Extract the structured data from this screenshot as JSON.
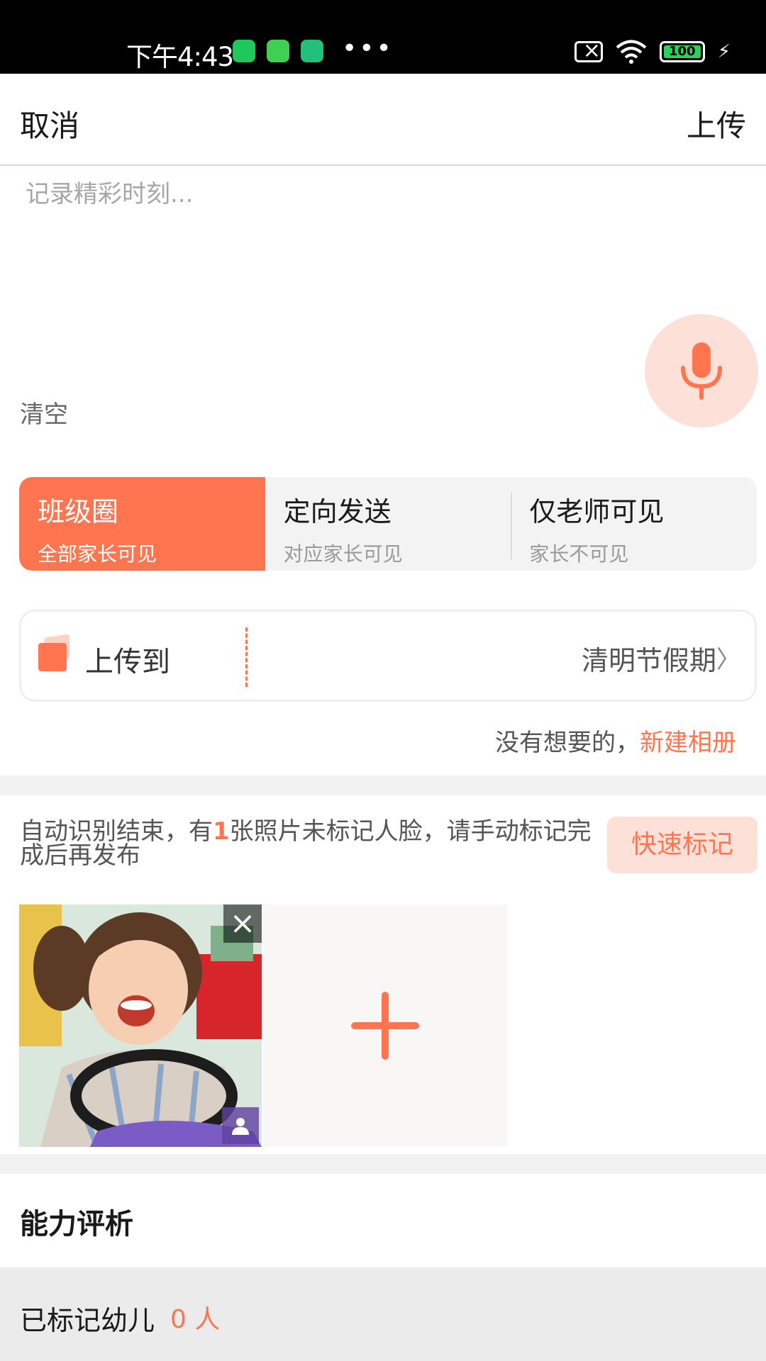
{
  "status_bar": {
    "time": "下午4:43",
    "battery": "100"
  },
  "nav": {
    "cancel_label": "取消",
    "upload_label": "上传"
  },
  "composer": {
    "placeholder": "记录精彩时刻...",
    "clear_label": "清空"
  },
  "audience": {
    "options": [
      {
        "title": "班级圈",
        "subtitle": "全部家长可见",
        "selected": true
      },
      {
        "title": "定向发送",
        "subtitle": "对应家长可见",
        "selected": false
      },
      {
        "title": "仅老师可见",
        "subtitle": "家长不可见",
        "selected": false
      }
    ]
  },
  "upload_to": {
    "label": "上传到",
    "album": "清明节假期"
  },
  "new_album": {
    "prefix": "没有想要的，",
    "link": "新建相册"
  },
  "notice": {
    "text_before": "自动识别结束，有",
    "count": "1",
    "text_after": "张照片未标记人脸，请手动标记完成后再发布",
    "quick_mark_label": "快速标记"
  },
  "ability": {
    "title": "能力评析"
  },
  "marked_children": {
    "label": "已标记幼儿",
    "count_text": "0 人"
  },
  "colors": {
    "accent": "#fe7550",
    "accent_light": "#fde1d8",
    "status_bar_bg": "#000000"
  }
}
